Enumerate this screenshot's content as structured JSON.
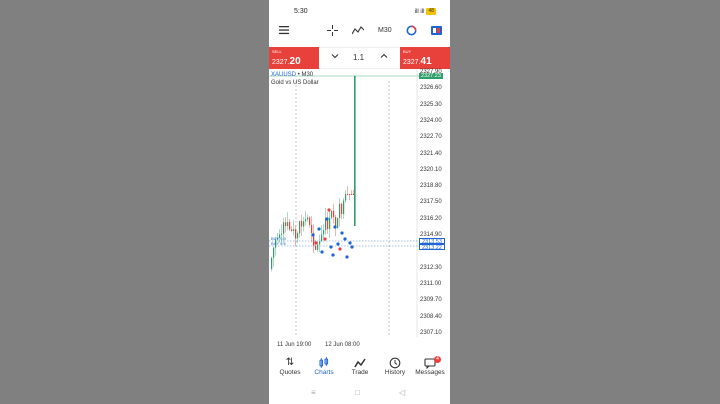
{
  "status_bar": {
    "time": "5:30",
    "signal": "ill ill",
    "battery": "48"
  },
  "toolbar": {
    "menu_icon": "hamburger-menu-icon",
    "crosshair_icon": "crosshair-icon",
    "indicators_icon": "indicator-icon",
    "timeframe": "M30",
    "objects_icon": "objects-icon",
    "account_icon": "account-icon"
  },
  "trade_bar": {
    "sell_label": "SELL",
    "sell_price_main": "2327.",
    "sell_price_big": "20",
    "buy_label": "BUY",
    "buy_price_main": "2327.",
    "buy_price_big": "41",
    "lot": "1.1",
    "decrease_icon": "chevron-down-icon",
    "increase_icon": "chevron-up-icon"
  },
  "chart": {
    "symbol": "XAUUSD",
    "symbol_tf": "• M30",
    "description": "Gold vs US Dollar",
    "current_price_tag": "2327.23",
    "order_tag_a": "2313.53",
    "order_tag_b": "2313.22",
    "order_label_a": "BUY 0.5",
    "order_label_b": "BUY 0.6",
    "y_ticks": [
      "2327.90",
      "2326.60",
      "2325.30",
      "2324.00",
      "2322.70",
      "2321.40",
      "2320.10",
      "2318.80",
      "2317.50",
      "2316.20",
      "2314.90",
      "2312.30",
      "2311.00",
      "2309.70",
      "2308.40",
      "2307.10"
    ],
    "x_ticks": [
      "11 Jun 19:00",
      "12 Jun 08:00"
    ],
    "colors": {
      "bull": "#2e9e6a",
      "bear": "#e8403a",
      "order": "#1e64d2"
    }
  },
  "bottom_nav": [
    {
      "label": "Quotes",
      "icon": "quotes-icon"
    },
    {
      "label": "Charts",
      "icon": "charts-icon"
    },
    {
      "label": "Trade",
      "icon": "trade-icon"
    },
    {
      "label": "History",
      "icon": "history-icon"
    },
    {
      "label": "Messages",
      "icon": "messages-icon",
      "badge": "4"
    }
  ],
  "system_nav": {
    "recents": "≡",
    "home": "□",
    "back": "◁"
  }
}
